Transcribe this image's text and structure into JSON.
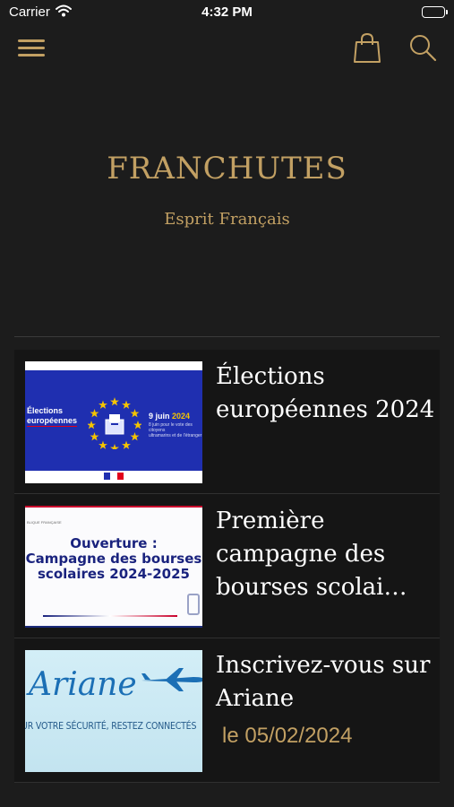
{
  "status_bar": {
    "carrier": "Carrier",
    "time": "4:32 PM"
  },
  "nav": {
    "icons": [
      "menu-icon",
      "shopping-bag-icon",
      "search-icon"
    ],
    "accent_color": "#c2a063"
  },
  "hero": {
    "title": "FRANCHUTES",
    "subtitle": "Esprit Français"
  },
  "articles": [
    {
      "title": "Élections européennes 2024",
      "thumbnail": {
        "heading_1": "Élections",
        "heading_2": "européennes",
        "date": "9 juin",
        "year": "2024",
        "small_1": "8 juin pour le vote des citoyens",
        "small_2": "ultramarins et de l'étranger"
      }
    },
    {
      "title": "Première campagne des bourses scolai…",
      "thumbnail": {
        "heading_1": "Ouverture :",
        "heading_2": "Campagne des bourses",
        "heading_3": "scolaires 2024-2025",
        "edge_text": "BLIQUE FRANÇAISE"
      }
    },
    {
      "title": "Inscrivez-vous sur Ariane",
      "date": "le 05/02/2024",
      "thumbnail": {
        "logo": "Ariane",
        "tagline": "UR VOTRE SÉCURITÉ, RESTEZ CONNECTÉS"
      }
    }
  ]
}
